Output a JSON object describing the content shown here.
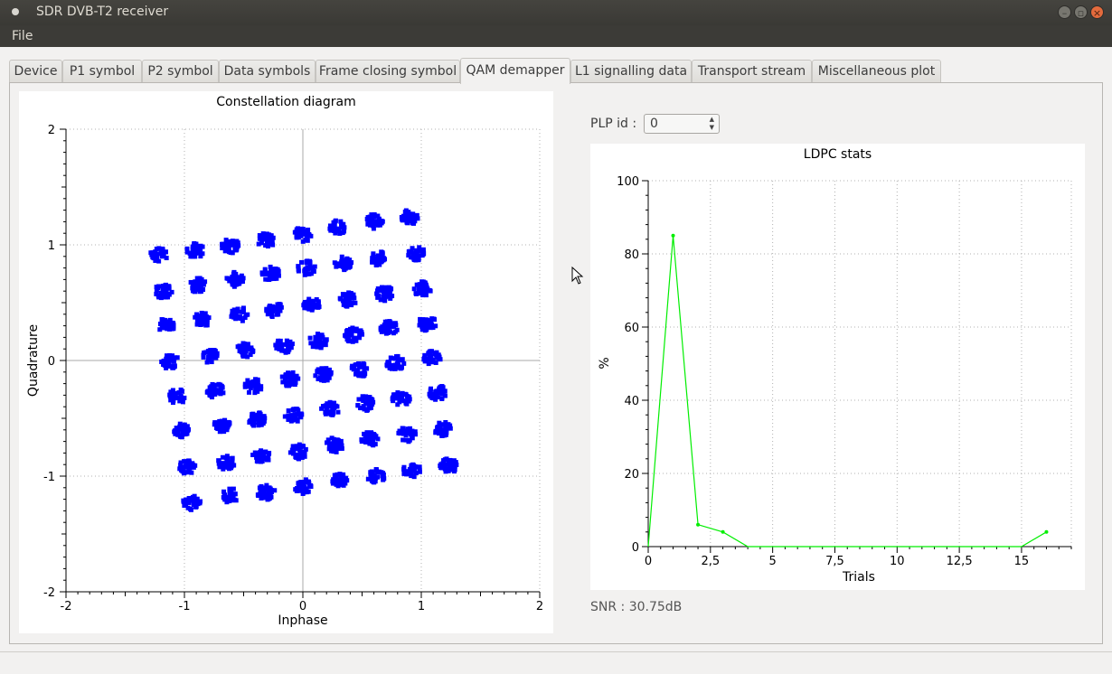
{
  "window": {
    "title": "SDR DVB-T2 receiver",
    "min": "–",
    "max": "▫",
    "close": "×"
  },
  "menu": {
    "file": "File"
  },
  "tabs": [
    {
      "label": "Device"
    },
    {
      "label": "P1 symbol"
    },
    {
      "label": "P2 symbol"
    },
    {
      "label": "Data symbols"
    },
    {
      "label": "Frame closing symbol"
    },
    {
      "label": "QAM demapper",
      "active": true
    },
    {
      "label": "L1 signalling data"
    },
    {
      "label": "Transport stream"
    },
    {
      "label": "Miscellaneous plot"
    }
  ],
  "plp": {
    "label": "PLP id :",
    "value": "0"
  },
  "snr": "SNR : 30.75dB",
  "chart_data": [
    {
      "type": "scatter",
      "title": "Constellation diagram",
      "xlabel": "Inphase",
      "ylabel": "Quadrature",
      "xlim": [
        -2,
        2
      ],
      "ylim": [
        -2,
        2
      ],
      "x_ticks": [
        "-2",
        "-1",
        "0",
        "1",
        "2"
      ],
      "y_ticks": [
        "-2",
        "-1",
        "0",
        "1",
        "2"
      ],
      "grid": true,
      "color": "#0000ff",
      "clusters": [
        [
          [
            -1.22,
            0.91
          ],
          [
            -0.91,
            0.95
          ],
          [
            -0.61,
            0.99
          ],
          [
            -0.31,
            1.04
          ],
          [
            0.0,
            1.09
          ],
          [
            0.3,
            1.15
          ],
          [
            0.6,
            1.2
          ],
          [
            0.9,
            1.24
          ]
        ],
        [
          [
            -1.18,
            0.6
          ],
          [
            -0.88,
            0.65
          ],
          [
            -0.57,
            0.7
          ],
          [
            -0.27,
            0.75
          ],
          [
            0.03,
            0.8
          ],
          [
            0.34,
            0.84
          ],
          [
            0.64,
            0.88
          ],
          [
            0.96,
            0.93
          ]
        ],
        [
          [
            -1.16,
            0.3
          ],
          [
            -0.85,
            0.35
          ],
          [
            -0.54,
            0.4
          ],
          [
            -0.24,
            0.44
          ],
          [
            0.07,
            0.49
          ],
          [
            0.38,
            0.53
          ],
          [
            0.69,
            0.58
          ],
          [
            1.01,
            0.62
          ]
        ],
        [
          [
            -1.12,
            -0.01
          ],
          [
            -0.79,
            0.04
          ],
          [
            -0.49,
            0.09
          ],
          [
            -0.16,
            0.13
          ],
          [
            0.13,
            0.17
          ],
          [
            0.43,
            0.22
          ],
          [
            0.73,
            0.28
          ],
          [
            1.05,
            0.32
          ]
        ],
        [
          [
            -1.06,
            -0.31
          ],
          [
            -0.74,
            -0.26
          ],
          [
            -0.42,
            -0.22
          ],
          [
            -0.11,
            -0.16
          ],
          [
            0.18,
            -0.12
          ],
          [
            0.48,
            -0.08
          ],
          [
            0.78,
            -0.02
          ],
          [
            1.09,
            0.02
          ]
        ],
        [
          [
            -1.02,
            -0.61
          ],
          [
            -0.69,
            -0.56
          ],
          [
            -0.39,
            -0.51
          ],
          [
            -0.08,
            -0.47
          ],
          [
            0.23,
            -0.42
          ],
          [
            0.53,
            -0.37
          ],
          [
            0.83,
            -0.33
          ],
          [
            1.14,
            -0.28
          ]
        ],
        [
          [
            -0.98,
            -0.92
          ],
          [
            -0.65,
            -0.88
          ],
          [
            -0.35,
            -0.83
          ],
          [
            -0.04,
            -0.79
          ],
          [
            0.27,
            -0.73
          ],
          [
            0.56,
            -0.68
          ],
          [
            0.88,
            -0.64
          ],
          [
            1.18,
            -0.59
          ]
        ],
        [
          [
            -0.94,
            -1.23
          ],
          [
            -0.61,
            -1.17
          ],
          [
            -0.31,
            -1.14
          ],
          [
            0.0,
            -1.09
          ],
          [
            0.31,
            -1.04
          ],
          [
            0.62,
            -1.0
          ],
          [
            0.92,
            -0.95
          ],
          [
            1.23,
            -0.91
          ]
        ]
      ]
    },
    {
      "type": "line",
      "title": "LDPC stats",
      "xlabel": "Trials",
      "ylabel": "%",
      "xlim": [
        0,
        17
      ],
      "ylim": [
        0,
        100
      ],
      "x_ticks": [
        "0",
        "2,5",
        "5",
        "7,5",
        "10",
        "12,5",
        "15"
      ],
      "y_ticks": [
        "0",
        "20",
        "40",
        "60",
        "80",
        "100"
      ],
      "grid": true,
      "color": "#00ee00",
      "x": [
        0,
        1,
        2,
        3,
        4,
        5,
        6,
        7,
        8,
        9,
        10,
        11,
        12,
        13,
        14,
        15,
        16
      ],
      "y": [
        0,
        85,
        6,
        4,
        0,
        0,
        0,
        0,
        0,
        0,
        0,
        0,
        0,
        0,
        0,
        0,
        4
      ]
    }
  ]
}
